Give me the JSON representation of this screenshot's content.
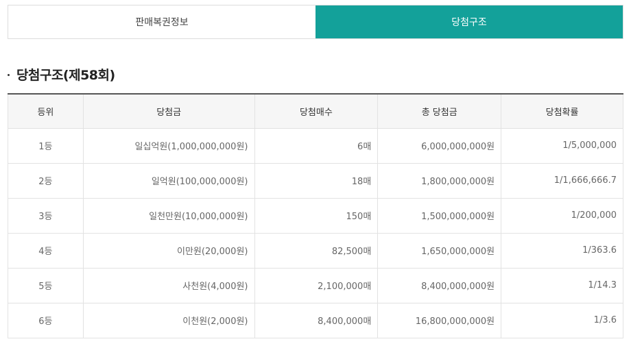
{
  "tabs": [
    {
      "label": "판매복권정보",
      "active": false
    },
    {
      "label": "당첨구조",
      "active": true
    }
  ],
  "section": {
    "title": "당첨구조(제58회)"
  },
  "colors": {
    "accent": "#13a19a",
    "header_bg": "#f6f6f6",
    "border": "#e2e2e2"
  },
  "table": {
    "headers": [
      "등위",
      "당첨금",
      "당첨매수",
      "총 당첨금",
      "당첨확률"
    ],
    "rows": [
      [
        "1등",
        "일십억원(1,000,000,000원)",
        "6매",
        "6,000,000,000원",
        "1/5,000,000"
      ],
      [
        "2등",
        "일억원(100,000,000원)",
        "18매",
        "1,800,000,000원",
        "1/1,666,666.7"
      ],
      [
        "3등",
        "일천만원(10,000,000원)",
        "150매",
        "1,500,000,000원",
        "1/200,000"
      ],
      [
        "4등",
        "이만원(20,000원)",
        "82,500매",
        "1,650,000,000원",
        "1/363.6"
      ],
      [
        "5등",
        "사천원(4,000원)",
        "2,100,000매",
        "8,400,000,000원",
        "1/14.3"
      ],
      [
        "6등",
        "이천원(2,000원)",
        "8,400,000매",
        "16,800,000,000원",
        "1/3.6"
      ]
    ]
  }
}
